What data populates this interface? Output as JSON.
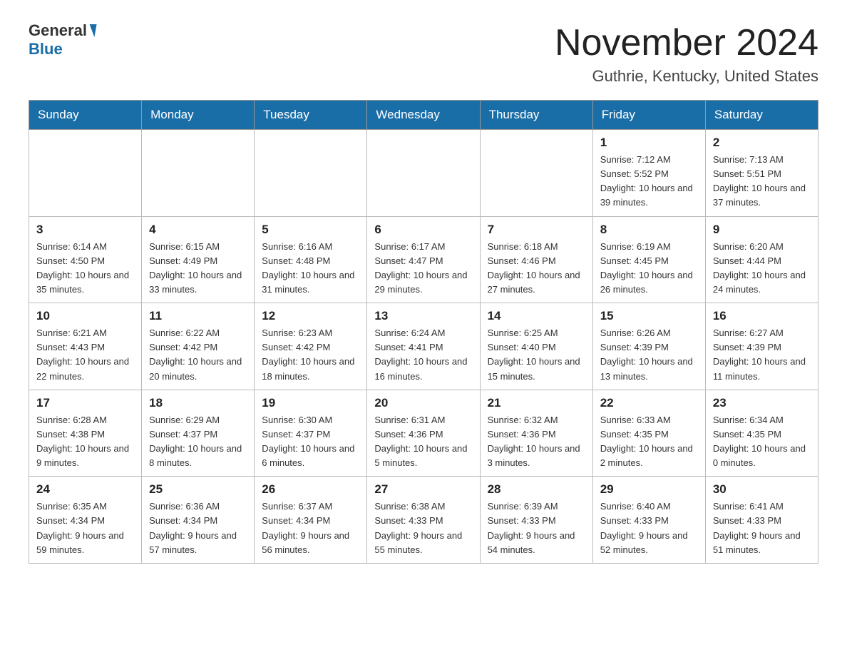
{
  "header": {
    "logo_general": "General",
    "logo_blue": "Blue",
    "month_title": "November 2024",
    "location": "Guthrie, Kentucky, United States"
  },
  "weekdays": [
    "Sunday",
    "Monday",
    "Tuesday",
    "Wednesday",
    "Thursday",
    "Friday",
    "Saturday"
  ],
  "weeks": [
    [
      {
        "day": "",
        "info": ""
      },
      {
        "day": "",
        "info": ""
      },
      {
        "day": "",
        "info": ""
      },
      {
        "day": "",
        "info": ""
      },
      {
        "day": "",
        "info": ""
      },
      {
        "day": "1",
        "info": "Sunrise: 7:12 AM\nSunset: 5:52 PM\nDaylight: 10 hours and 39 minutes."
      },
      {
        "day": "2",
        "info": "Sunrise: 7:13 AM\nSunset: 5:51 PM\nDaylight: 10 hours and 37 minutes."
      }
    ],
    [
      {
        "day": "3",
        "info": "Sunrise: 6:14 AM\nSunset: 4:50 PM\nDaylight: 10 hours and 35 minutes."
      },
      {
        "day": "4",
        "info": "Sunrise: 6:15 AM\nSunset: 4:49 PM\nDaylight: 10 hours and 33 minutes."
      },
      {
        "day": "5",
        "info": "Sunrise: 6:16 AM\nSunset: 4:48 PM\nDaylight: 10 hours and 31 minutes."
      },
      {
        "day": "6",
        "info": "Sunrise: 6:17 AM\nSunset: 4:47 PM\nDaylight: 10 hours and 29 minutes."
      },
      {
        "day": "7",
        "info": "Sunrise: 6:18 AM\nSunset: 4:46 PM\nDaylight: 10 hours and 27 minutes."
      },
      {
        "day": "8",
        "info": "Sunrise: 6:19 AM\nSunset: 4:45 PM\nDaylight: 10 hours and 26 minutes."
      },
      {
        "day": "9",
        "info": "Sunrise: 6:20 AM\nSunset: 4:44 PM\nDaylight: 10 hours and 24 minutes."
      }
    ],
    [
      {
        "day": "10",
        "info": "Sunrise: 6:21 AM\nSunset: 4:43 PM\nDaylight: 10 hours and 22 minutes."
      },
      {
        "day": "11",
        "info": "Sunrise: 6:22 AM\nSunset: 4:42 PM\nDaylight: 10 hours and 20 minutes."
      },
      {
        "day": "12",
        "info": "Sunrise: 6:23 AM\nSunset: 4:42 PM\nDaylight: 10 hours and 18 minutes."
      },
      {
        "day": "13",
        "info": "Sunrise: 6:24 AM\nSunset: 4:41 PM\nDaylight: 10 hours and 16 minutes."
      },
      {
        "day": "14",
        "info": "Sunrise: 6:25 AM\nSunset: 4:40 PM\nDaylight: 10 hours and 15 minutes."
      },
      {
        "day": "15",
        "info": "Sunrise: 6:26 AM\nSunset: 4:39 PM\nDaylight: 10 hours and 13 minutes."
      },
      {
        "day": "16",
        "info": "Sunrise: 6:27 AM\nSunset: 4:39 PM\nDaylight: 10 hours and 11 minutes."
      }
    ],
    [
      {
        "day": "17",
        "info": "Sunrise: 6:28 AM\nSunset: 4:38 PM\nDaylight: 10 hours and 9 minutes."
      },
      {
        "day": "18",
        "info": "Sunrise: 6:29 AM\nSunset: 4:37 PM\nDaylight: 10 hours and 8 minutes."
      },
      {
        "day": "19",
        "info": "Sunrise: 6:30 AM\nSunset: 4:37 PM\nDaylight: 10 hours and 6 minutes."
      },
      {
        "day": "20",
        "info": "Sunrise: 6:31 AM\nSunset: 4:36 PM\nDaylight: 10 hours and 5 minutes."
      },
      {
        "day": "21",
        "info": "Sunrise: 6:32 AM\nSunset: 4:36 PM\nDaylight: 10 hours and 3 minutes."
      },
      {
        "day": "22",
        "info": "Sunrise: 6:33 AM\nSunset: 4:35 PM\nDaylight: 10 hours and 2 minutes."
      },
      {
        "day": "23",
        "info": "Sunrise: 6:34 AM\nSunset: 4:35 PM\nDaylight: 10 hours and 0 minutes."
      }
    ],
    [
      {
        "day": "24",
        "info": "Sunrise: 6:35 AM\nSunset: 4:34 PM\nDaylight: 9 hours and 59 minutes."
      },
      {
        "day": "25",
        "info": "Sunrise: 6:36 AM\nSunset: 4:34 PM\nDaylight: 9 hours and 57 minutes."
      },
      {
        "day": "26",
        "info": "Sunrise: 6:37 AM\nSunset: 4:34 PM\nDaylight: 9 hours and 56 minutes."
      },
      {
        "day": "27",
        "info": "Sunrise: 6:38 AM\nSunset: 4:33 PM\nDaylight: 9 hours and 55 minutes."
      },
      {
        "day": "28",
        "info": "Sunrise: 6:39 AM\nSunset: 4:33 PM\nDaylight: 9 hours and 54 minutes."
      },
      {
        "day": "29",
        "info": "Sunrise: 6:40 AM\nSunset: 4:33 PM\nDaylight: 9 hours and 52 minutes."
      },
      {
        "day": "30",
        "info": "Sunrise: 6:41 AM\nSunset: 4:33 PM\nDaylight: 9 hours and 51 minutes."
      }
    ]
  ]
}
